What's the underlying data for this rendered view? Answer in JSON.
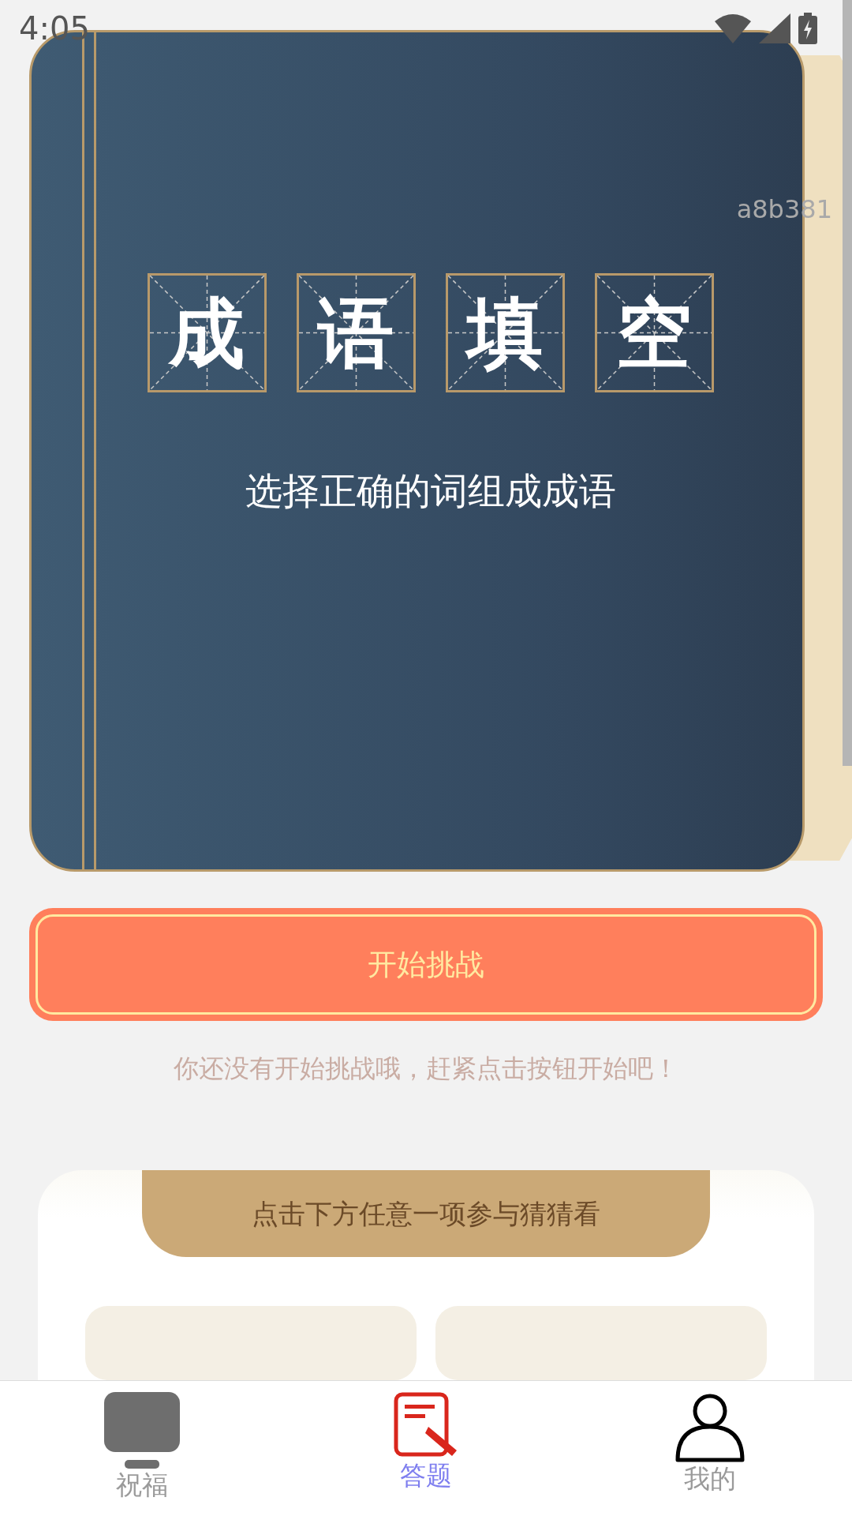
{
  "status_bar": {
    "time": "4:05"
  },
  "book": {
    "title_chars": [
      "成",
      "语",
      "填",
      "空"
    ],
    "subtitle": "选择正确的词组成成语",
    "corner_code": "a8b381"
  },
  "start_button": {
    "label": "开始挑战"
  },
  "hint": "你还没有开始挑战哦，赶紧点击按钮开始吧！",
  "guess_panel": {
    "header": "点击下方任意一项参与猜猜看"
  },
  "bottom_nav": [
    {
      "label": "祝福",
      "selected": false
    },
    {
      "label": "答题",
      "selected": true
    },
    {
      "label": "我的",
      "selected": false
    }
  ]
}
